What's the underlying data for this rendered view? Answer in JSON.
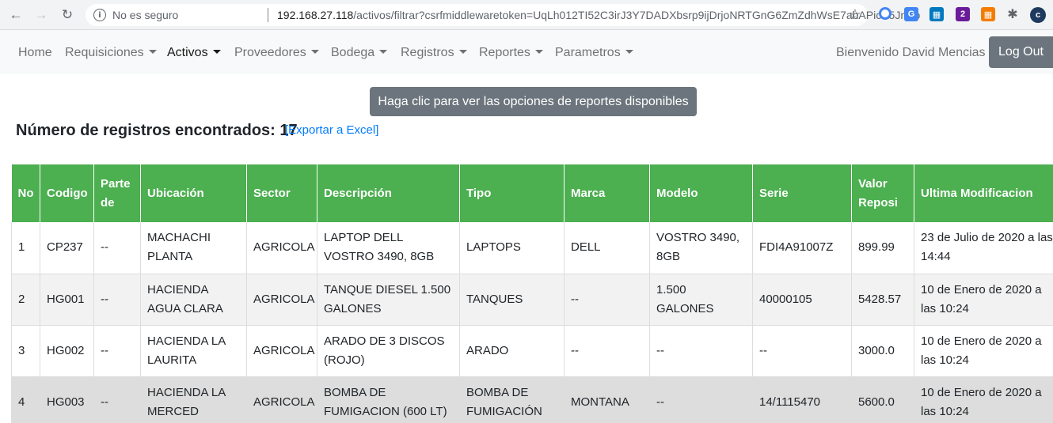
{
  "browser": {
    "insecure_label": "No es seguro",
    "url_host": "192.168.27.118",
    "url_rest": "/activos/filtrar?csrfmiddlewaretoken=UqLh012TI52C3irJ3Y7DADXbsrp9ijDrjoNRTGnG6ZmZdhWsE7abAPicK5JnEowc..."
  },
  "navbar": {
    "items": [
      {
        "label": "Home"
      },
      {
        "label": "Requisiciones"
      },
      {
        "label": "Activos"
      },
      {
        "label": "Proveedores"
      },
      {
        "label": "Bodega"
      },
      {
        "label": "Registros"
      },
      {
        "label": "Reportes"
      },
      {
        "label": "Parametros"
      }
    ],
    "active_index": 2,
    "welcome": "Bienvenido David Mencias",
    "logout_label": "Log Out"
  },
  "reports_button_label": "Haga clic para ver las opciones de reportes disponibles",
  "records": {
    "count_label": "Número de registros encontrados: 17",
    "export_label": "[Exportar a Excel]"
  },
  "table": {
    "headers": [
      "No",
      "Codigo",
      "Parte de",
      "Ubicación",
      "Sector",
      "Descripción",
      "Tipo",
      "Marca",
      "Modelo",
      "Serie",
      "Valor Reposi",
      "Ultima Modificacion"
    ],
    "rows": [
      [
        "1",
        "CP237",
        "--",
        "MACHACHI PLANTA",
        "AGRICOLA",
        "LAPTOP DELL VOSTRO 3490, 8GB",
        "LAPTOPS",
        "DELL",
        "VOSTRO 3490, 8GB",
        "FDI4A91007Z",
        "899.99",
        "23 de Julio de 2020 a las 14:44"
      ],
      [
        "2",
        "HG001",
        "--",
        "HACIENDA AGUA CLARA",
        "AGRICOLA",
        "TANQUE DIESEL 1.500 GALONES",
        "TANQUES",
        "--",
        "1.500 GALONES",
        "40000105",
        "5428.57",
        "10 de Enero de 2020 a las 10:24"
      ],
      [
        "3",
        "HG002",
        "--",
        "HACIENDA LA LAURITA",
        "AGRICOLA",
        "ARADO DE 3 DISCOS (ROJO)",
        "ARADO",
        "--",
        "--",
        "--",
        "3000.0",
        "10 de Enero de 2020 a las 10:24"
      ],
      [
        "4",
        "HG003",
        "--",
        "HACIENDA LA MERCED",
        "AGRICOLA",
        "BOMBA DE FUMIGACION (600 LT)",
        "BOMBA DE FUMIGACIÓN",
        "MONTANA",
        "--",
        "14/1115470",
        "5600.0",
        "10 de Enero de 2020 a las 10:24"
      ]
    ]
  },
  "colors": {
    "table_header": "#4caf50",
    "button_gray": "#6c757d",
    "link_blue": "#007bff"
  }
}
